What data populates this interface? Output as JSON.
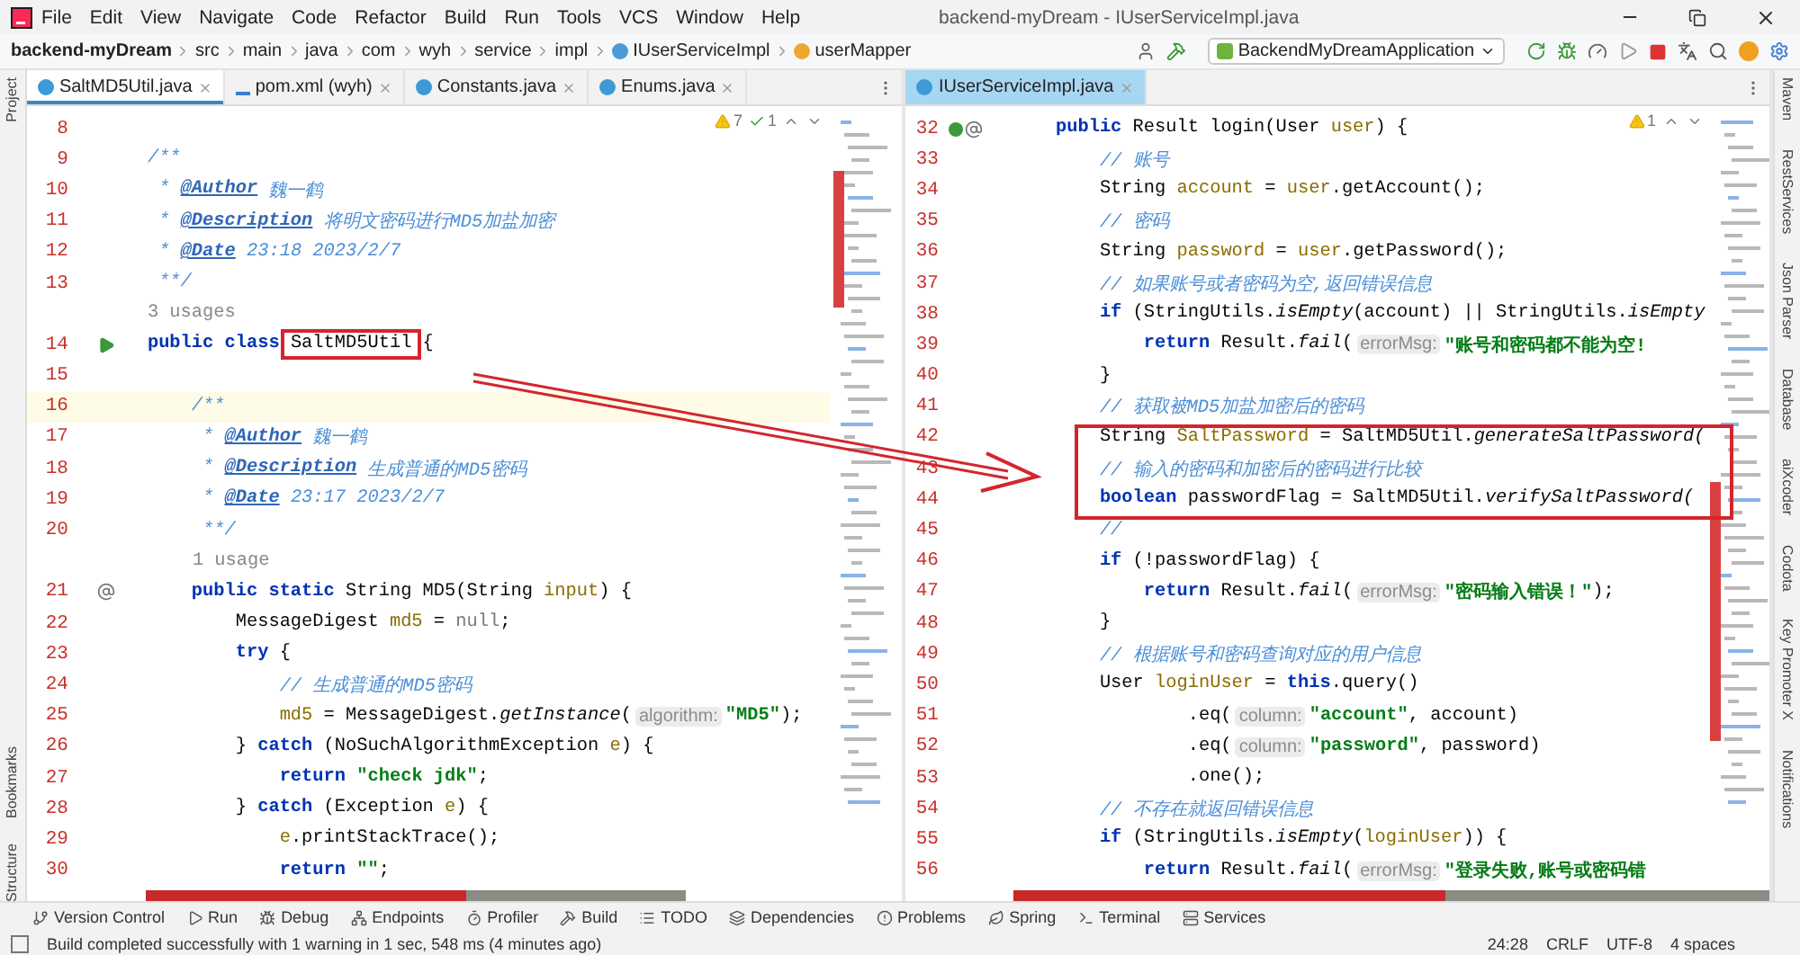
{
  "menu": [
    "File",
    "Edit",
    "View",
    "Navigate",
    "Code",
    "Refactor",
    "Build",
    "Run",
    "Tools",
    "VCS",
    "Window",
    "Help"
  ],
  "window_title": "backend-myDream - IUserServiceImpl.java",
  "breadcrumbs": [
    {
      "label": "backend-myDream",
      "kind": "project"
    },
    {
      "label": "src",
      "kind": "folder"
    },
    {
      "label": "main",
      "kind": "folder"
    },
    {
      "label": "java",
      "kind": "folder"
    },
    {
      "label": "com",
      "kind": "folder"
    },
    {
      "label": "wyh",
      "kind": "folder"
    },
    {
      "label": "service",
      "kind": "folder"
    },
    {
      "label": "impl",
      "kind": "folder"
    },
    {
      "label": "IUserServiceImpl",
      "kind": "class"
    },
    {
      "label": "userMapper",
      "kind": "field"
    }
  ],
  "run_config": "BackendMyDreamApplication",
  "left_stripe": [
    "Project",
    "Bookmarks",
    "Structure"
  ],
  "right_stripe": [
    "Maven",
    "RestServices",
    "Json Parser",
    "Database",
    "aiXcoder",
    "Codota",
    "Key Promoter X",
    "Notifications"
  ],
  "editors": [
    {
      "active": false,
      "inspections": [
        {
          "kind": "warning",
          "count": "7"
        },
        {
          "kind": "ok",
          "count": "1"
        }
      ],
      "tabs": [
        {
          "label": "SaltMD5Util.java",
          "kind": "class",
          "selected": true
        },
        {
          "label": "pom.xml (wyh)",
          "kind": "maven",
          "selected": false
        },
        {
          "label": "Constants.java",
          "kind": "class",
          "selected": false
        },
        {
          "label": "Enums.java",
          "kind": "class",
          "selected": false
        }
      ],
      "lines": [
        {
          "kind": "code",
          "n": "8",
          "current": false
        },
        {
          "kind": "code",
          "n": "9",
          "current": false,
          "toks": [
            {
              "kind": "cm",
              "text": "/**"
            }
          ]
        },
        {
          "kind": "code",
          "n": "10",
          "current": false,
          "toks": [
            {
              "kind": "cm",
              "text": " * "
            },
            {
              "kind": "tag",
              "text": "@Author"
            },
            {
              "kind": "cm",
              "text": " 魏一鹤"
            }
          ]
        },
        {
          "kind": "code",
          "n": "11",
          "current": false,
          "toks": [
            {
              "kind": "cm",
              "text": " * "
            },
            {
              "kind": "tag",
              "text": "@Description"
            },
            {
              "kind": "cm",
              "text": " 将明文密码进行MD5加盐加密"
            }
          ]
        },
        {
          "kind": "code",
          "n": "12",
          "current": false,
          "toks": [
            {
              "kind": "cm",
              "text": " * "
            },
            {
              "kind": "tag",
              "text": "@Date"
            },
            {
              "kind": "cm",
              "text": " 23:18 2023/2/7"
            }
          ]
        },
        {
          "kind": "code",
          "n": "13",
          "current": false,
          "toks": [
            {
              "kind": "cm",
              "text": " **/"
            }
          ]
        },
        {
          "kind": "usages",
          "text": "3 usages",
          "nested": false
        },
        {
          "kind": "code",
          "n": "14",
          "current": false,
          "gutter": {
            "kind": "run"
          },
          "toks": [
            {
              "kind": "kw",
              "text": "public class "
            },
            {
              "kind": "boxed",
              "text": "SaltMD5Util"
            },
            {
              "kind": "pl",
              "text": " {"
            }
          ]
        },
        {
          "kind": "code",
          "n": "15",
          "current": false
        },
        {
          "kind": "code",
          "n": "16",
          "current": true,
          "toks": [
            {
              "kind": "cm",
              "text": "    /**"
            }
          ]
        },
        {
          "kind": "code",
          "n": "17",
          "current": false,
          "toks": [
            {
              "kind": "cm",
              "text": "     * "
            },
            {
              "kind": "tag",
              "text": "@Author"
            },
            {
              "kind": "cm",
              "text": " 魏一鹤"
            }
          ]
        },
        {
          "kind": "code",
          "n": "18",
          "current": false,
          "toks": [
            {
              "kind": "cm",
              "text": "     * "
            },
            {
              "kind": "tag",
              "text": "@Description"
            },
            {
              "kind": "cm",
              "text": " 生成普通的MD5密码"
            }
          ]
        },
        {
          "kind": "code",
          "n": "19",
          "current": false,
          "toks": [
            {
              "kind": "cm",
              "text": "     * "
            },
            {
              "kind": "tag",
              "text": "@Date"
            },
            {
              "kind": "cm",
              "text": " 23:17 2023/2/7"
            }
          ]
        },
        {
          "kind": "code",
          "n": "20",
          "current": false,
          "toks": [
            {
              "kind": "cm",
              "text": "     **/"
            }
          ]
        },
        {
          "kind": "usages",
          "text": "1 usage",
          "nested": true
        },
        {
          "kind": "code",
          "n": "21",
          "current": false,
          "gutter": {
            "kind": "at"
          },
          "toks": [
            {
              "kind": "kw",
              "text": "    public static "
            },
            {
              "kind": "pl",
              "text": "String MD5(String "
            },
            {
              "kind": "var",
              "text": "input"
            },
            {
              "kind": "pl",
              "text": ") {"
            }
          ]
        },
        {
          "kind": "code",
          "n": "22",
          "current": false,
          "toks": [
            {
              "kind": "pl",
              "text": "        MessageDigest "
            },
            {
              "kind": "var",
              "text": "md5"
            },
            {
              "kind": "pl",
              "text": " = "
            },
            {
              "kind": "nul",
              "text": "null"
            },
            {
              "kind": "pl",
              "text": ";"
            }
          ]
        },
        {
          "kind": "code",
          "n": "23",
          "current": false,
          "toks": [
            {
              "kind": "kw",
              "text": "        try"
            },
            {
              "kind": "pl",
              "text": " {"
            }
          ]
        },
        {
          "kind": "code",
          "n": "24",
          "current": false,
          "toks": [
            {
              "kind": "cm",
              "text": "            // 生成普通的MD5密码"
            }
          ]
        },
        {
          "kind": "code",
          "n": "25",
          "current": false,
          "toks": [
            {
              "kind": "var",
              "text": "            md5"
            },
            {
              "kind": "pl",
              "text": " = MessageDigest."
            },
            {
              "kind": "it",
              "text": "getInstance"
            },
            {
              "kind": "pl",
              "text": "("
            },
            {
              "kind": "hint",
              "text": "algorithm:"
            },
            {
              "kind": "str",
              "text": "\"MD5\""
            },
            {
              "kind": "pl",
              "text": ");"
            }
          ]
        },
        {
          "kind": "code",
          "n": "26",
          "current": false,
          "toks": [
            {
              "kind": "pl",
              "text": "        } "
            },
            {
              "kind": "kw",
              "text": "catch"
            },
            {
              "kind": "pl",
              "text": " (NoSuchAlgorithmException "
            },
            {
              "kind": "var",
              "text": "e"
            },
            {
              "kind": "pl",
              "text": ") {"
            }
          ]
        },
        {
          "kind": "code",
          "n": "27",
          "current": false,
          "toks": [
            {
              "kind": "kw",
              "text": "            return "
            },
            {
              "kind": "str",
              "text": "\"check jdk\""
            },
            {
              "kind": "pl",
              "text": ";"
            }
          ]
        },
        {
          "kind": "code",
          "n": "28",
          "current": false,
          "toks": [
            {
              "kind": "pl",
              "text": "        } "
            },
            {
              "kind": "kw",
              "text": "catch"
            },
            {
              "kind": "pl",
              "text": " (Exception "
            },
            {
              "kind": "var",
              "text": "e"
            },
            {
              "kind": "pl",
              "text": ") {"
            }
          ]
        },
        {
          "kind": "code",
          "n": "29",
          "current": false,
          "toks": [
            {
              "kind": "var",
              "text": "            e"
            },
            {
              "kind": "pl",
              "text": ".printStackTrace();"
            }
          ]
        },
        {
          "kind": "code",
          "n": "30",
          "current": false,
          "toks": [
            {
              "kind": "kw",
              "text": "            return "
            },
            {
              "kind": "str",
              "text": "\"\""
            },
            {
              "kind": "pl",
              "text": ";"
            }
          ]
        }
      ]
    },
    {
      "active": true,
      "inspections": [
        {
          "kind": "warning",
          "count": "1"
        }
      ],
      "tabs": [
        {
          "label": "IUserServiceImpl.java",
          "kind": "class",
          "selected": true
        }
      ],
      "lines": [
        {
          "kind": "code",
          "n": "32",
          "current": false,
          "gutter": {
            "kind": "impl"
          },
          "toks": [
            {
              "kind": "kw",
              "text": "public "
            },
            {
              "kind": "pl",
              "text": "Result login(User "
            },
            {
              "kind": "var",
              "text": "user"
            },
            {
              "kind": "pl",
              "text": ") {"
            }
          ]
        },
        {
          "kind": "code",
          "n": "33",
          "current": false,
          "toks": [
            {
              "kind": "cm",
              "text": "    // 账号"
            }
          ]
        },
        {
          "kind": "code",
          "n": "34",
          "current": false,
          "toks": [
            {
              "kind": "pl",
              "text": "    String "
            },
            {
              "kind": "var",
              "text": "account"
            },
            {
              "kind": "pl",
              "text": " = "
            },
            {
              "kind": "var",
              "text": "user"
            },
            {
              "kind": "pl",
              "text": ".getAccount();"
            }
          ]
        },
        {
          "kind": "code",
          "n": "35",
          "current": false,
          "toks": [
            {
              "kind": "cm",
              "text": "    // 密码"
            }
          ]
        },
        {
          "kind": "code",
          "n": "36",
          "current": false,
          "toks": [
            {
              "kind": "pl",
              "text": "    String "
            },
            {
              "kind": "var",
              "text": "password"
            },
            {
              "kind": "pl",
              "text": " = "
            },
            {
              "kind": "var",
              "text": "user"
            },
            {
              "kind": "pl",
              "text": ".getPassword();"
            }
          ]
        },
        {
          "kind": "code",
          "n": "37",
          "current": false,
          "toks": [
            {
              "kind": "cm",
              "text": "    // 如果账号或者密码为空,返回错误信息"
            }
          ]
        },
        {
          "kind": "code",
          "n": "38",
          "current": false,
          "toks": [
            {
              "kind": "kw",
              "text": "    if"
            },
            {
              "kind": "pl",
              "text": " (StringUtils."
            },
            {
              "kind": "it",
              "text": "isEmpty"
            },
            {
              "kind": "pl",
              "text": "(account) || StringUtils."
            },
            {
              "kind": "it",
              "text": "isEmpty"
            }
          ]
        },
        {
          "kind": "code",
          "n": "39",
          "current": false,
          "toks": [
            {
              "kind": "kw",
              "text": "        return "
            },
            {
              "kind": "pl",
              "text": "Result."
            },
            {
              "kind": "it",
              "text": "fail"
            },
            {
              "kind": "pl",
              "text": "("
            },
            {
              "kind": "hint",
              "text": "errorMsg:"
            },
            {
              "kind": "str",
              "text": "\"账号和密码都不能为空!"
            }
          ]
        },
        {
          "kind": "code",
          "n": "40",
          "current": false,
          "toks": [
            {
              "kind": "pl",
              "text": "    }"
            }
          ]
        },
        {
          "kind": "code",
          "n": "41",
          "current": false,
          "toks": [
            {
              "kind": "cm",
              "text": "    // 获取被MD5加盐加密后的密码"
            }
          ]
        },
        {
          "kind": "code",
          "n": "42",
          "current": false,
          "toks": [
            {
              "kind": "pl",
              "text": "    String "
            },
            {
              "kind": "var",
              "text": "SaltPassword"
            },
            {
              "kind": "pl",
              "text": " = SaltMD5Util."
            },
            {
              "kind": "it",
              "text": "generateSaltPassword("
            }
          ]
        },
        {
          "kind": "code",
          "n": "43",
          "current": false,
          "toks": [
            {
              "kind": "cm",
              "text": "    // 输入的密码和加密后的密码进行比较"
            }
          ]
        },
        {
          "kind": "code",
          "n": "44",
          "current": false,
          "toks": [
            {
              "kind": "kw",
              "text": "    boolean "
            },
            {
              "kind": "pl",
              "text": "passwordFlag = SaltMD5Util."
            },
            {
              "kind": "it",
              "text": "verifySaltPassword("
            }
          ]
        },
        {
          "kind": "code",
          "n": "45",
          "current": false,
          "toks": [
            {
              "kind": "cm",
              "text": "    //"
            }
          ]
        },
        {
          "kind": "code",
          "n": "46",
          "current": false,
          "toks": [
            {
              "kind": "kw",
              "text": "    if"
            },
            {
              "kind": "pl",
              "text": " (!passwordFlag) {"
            }
          ]
        },
        {
          "kind": "code",
          "n": "47",
          "current": false,
          "toks": [
            {
              "kind": "kw",
              "text": "        return "
            },
            {
              "kind": "pl",
              "text": "Result."
            },
            {
              "kind": "it",
              "text": "fail"
            },
            {
              "kind": "pl",
              "text": "("
            },
            {
              "kind": "hint",
              "text": "errorMsg:"
            },
            {
              "kind": "str",
              "text": "\"密码输入错误！\""
            },
            {
              "kind": "pl",
              "text": ");"
            }
          ]
        },
        {
          "kind": "code",
          "n": "48",
          "current": false,
          "toks": [
            {
              "kind": "pl",
              "text": "    }"
            }
          ]
        },
        {
          "kind": "code",
          "n": "49",
          "current": false,
          "toks": [
            {
              "kind": "cm",
              "text": "    // 根据账号和密码查询对应的用户信息"
            }
          ]
        },
        {
          "kind": "code",
          "n": "50",
          "current": false,
          "toks": [
            {
              "kind": "pl",
              "text": "    User "
            },
            {
              "kind": "var",
              "text": "loginUser"
            },
            {
              "kind": "pl",
              "text": " = "
            },
            {
              "kind": "kw",
              "text": "this"
            },
            {
              "kind": "pl",
              "text": ".query()"
            }
          ]
        },
        {
          "kind": "code",
          "n": "51",
          "current": false,
          "toks": [
            {
              "kind": "pl",
              "text": "            .eq("
            },
            {
              "kind": "hint",
              "text": "column:"
            },
            {
              "kind": "str",
              "text": "\"account\""
            },
            {
              "kind": "pl",
              "text": ", account)"
            }
          ]
        },
        {
          "kind": "code",
          "n": "52",
          "current": false,
          "toks": [
            {
              "kind": "pl",
              "text": "            .eq("
            },
            {
              "kind": "hint",
              "text": "column:"
            },
            {
              "kind": "str",
              "text": "\"password\""
            },
            {
              "kind": "pl",
              "text": ", password)"
            }
          ]
        },
        {
          "kind": "code",
          "n": "53",
          "current": false,
          "toks": [
            {
              "kind": "pl",
              "text": "            .one();"
            }
          ]
        },
        {
          "kind": "code",
          "n": "54",
          "current": false,
          "toks": [
            {
              "kind": "cm",
              "text": "    // 不存在就返回错误信息"
            }
          ]
        },
        {
          "kind": "code",
          "n": "55",
          "current": false,
          "toks": [
            {
              "kind": "kw",
              "text": "    if"
            },
            {
              "kind": "pl",
              "text": " (StringUtils."
            },
            {
              "kind": "it",
              "text": "isEmpty"
            },
            {
              "kind": "pl",
              "text": "("
            },
            {
              "kind": "var",
              "text": "loginUser"
            },
            {
              "kind": "pl",
              "text": ")) {"
            }
          ]
        },
        {
          "kind": "code",
          "n": "56",
          "current": false,
          "toks": [
            {
              "kind": "kw",
              "text": "        return "
            },
            {
              "kind": "pl",
              "text": "Result."
            },
            {
              "kind": "it",
              "text": "fail"
            },
            {
              "kind": "pl",
              "text": "("
            },
            {
              "kind": "hint",
              "text": "errorMsg:"
            },
            {
              "kind": "str",
              "text": "\"登录失败,账号或密码错"
            }
          ]
        }
      ]
    }
  ],
  "tool_windows": [
    {
      "label": "Version Control",
      "kind": "vcs"
    },
    {
      "label": "Run",
      "kind": "run"
    },
    {
      "label": "Debug",
      "kind": "debug"
    },
    {
      "label": "Endpoints",
      "kind": "endpoints"
    },
    {
      "label": "Profiler",
      "kind": "profiler"
    },
    {
      "label": "Build",
      "kind": "build"
    },
    {
      "label": "TODO",
      "kind": "todo"
    },
    {
      "label": "Dependencies",
      "kind": "deps"
    },
    {
      "label": "Problems",
      "kind": "problems"
    },
    {
      "label": "Spring",
      "kind": "spring"
    },
    {
      "label": "Terminal",
      "kind": "terminal"
    },
    {
      "label": "Services",
      "kind": "services"
    }
  ],
  "status": {
    "message": "Build completed successfully with 1 warning in 1 sec, 548 ms (4 minutes ago)",
    "position": "24:28",
    "line_separator": "CRLF",
    "encoding": "UTF-8",
    "indent": "4 spaces"
  }
}
